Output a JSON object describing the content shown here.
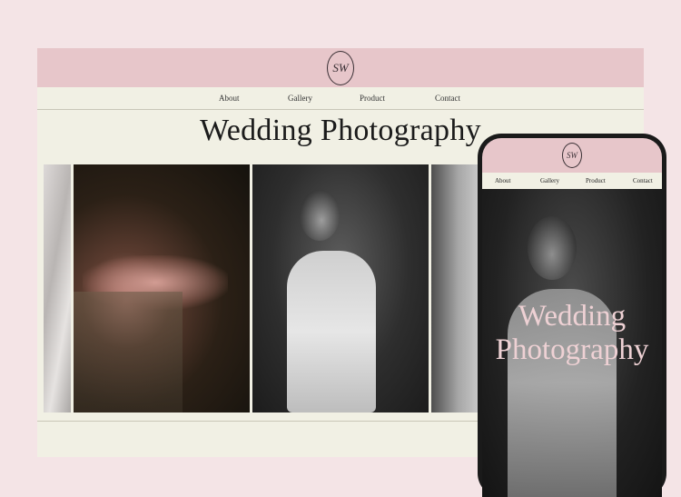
{
  "site": {
    "logo_text": "SW",
    "nav": [
      "About",
      "Gallery",
      "Product",
      "Contact"
    ],
    "hero_title": "Wedding Photography"
  },
  "mobile": {
    "logo_text": "SW",
    "nav": [
      "About",
      "Gallery",
      "Product",
      "Contact"
    ],
    "hero_title": "Wedding Photography"
  },
  "colors": {
    "page_background": "#f4e4e6",
    "header_pink": "#e7c6ca",
    "cream": "#f1f0e4",
    "title_pink": "#eed1d4"
  },
  "icons": {
    "logo": "monogram-logo"
  }
}
